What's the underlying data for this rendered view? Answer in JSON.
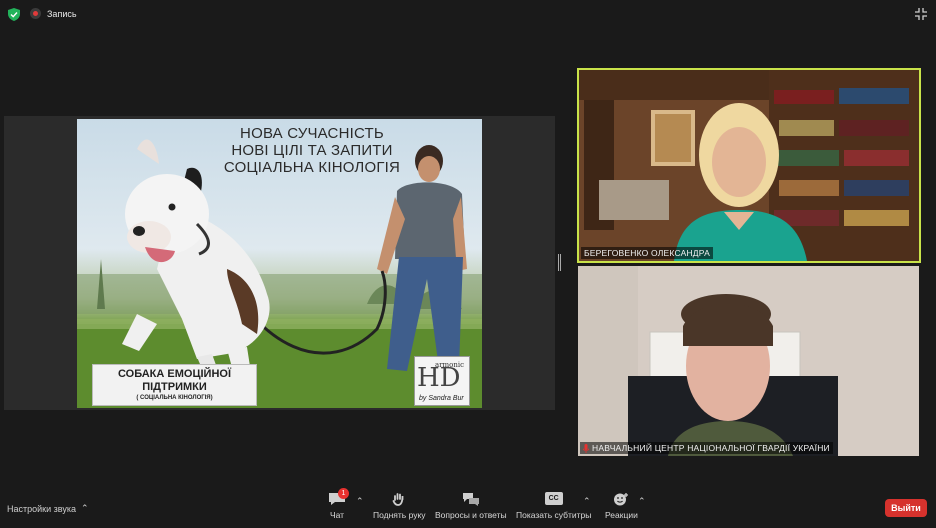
{
  "top_bar": {
    "recording_label": "Запись"
  },
  "slide": {
    "title_lines": [
      "НОВА СУЧАСНІСТЬ",
      "НОВІ ЦІЛІ ТА ЗАПИТИ",
      "СОЦІАЛЬНА КІНОЛОГІЯ"
    ],
    "caption_line1": "СОБАКА ЕМОЦІЙНОЇ",
    "caption_line2": "ПІДТРИМКИ",
    "caption_line3": "( СОЦІАЛЬНА КІНОЛОГІЯ)",
    "logo_text_top": "armonic",
    "logo_letters": "HD",
    "logo_text_bottom": "by Sandra Bur"
  },
  "participants": [
    {
      "name": "БЕРЕГОВЕНКО ОЛЕКСАНДРА",
      "active_speaker": true,
      "muted": false
    },
    {
      "name": "НАВЧАЛЬНИЙ ЦЕНТР НАЦІОНАЛЬНОЇ ГВАРДІЇ УКРАЇНИ",
      "active_speaker": false,
      "muted": true
    }
  ],
  "toolbar": {
    "audio_settings_label": "Настройки звука",
    "chat_label": "Чат",
    "chat_badge": "1",
    "raise_hand_label": "Поднять руку",
    "qa_label": "Вопросы и ответы",
    "captions_label": "Показать субтитры",
    "captions_icon_text": "CC",
    "reactions_label": "Реакции",
    "leave_label": "Выйти"
  },
  "colors": {
    "background": "#1a1a1a",
    "active_speaker_border": "#c9e34a",
    "leave_button": "#d6322d",
    "badge": "#e8312f",
    "record_dot": "#e03b3b"
  }
}
